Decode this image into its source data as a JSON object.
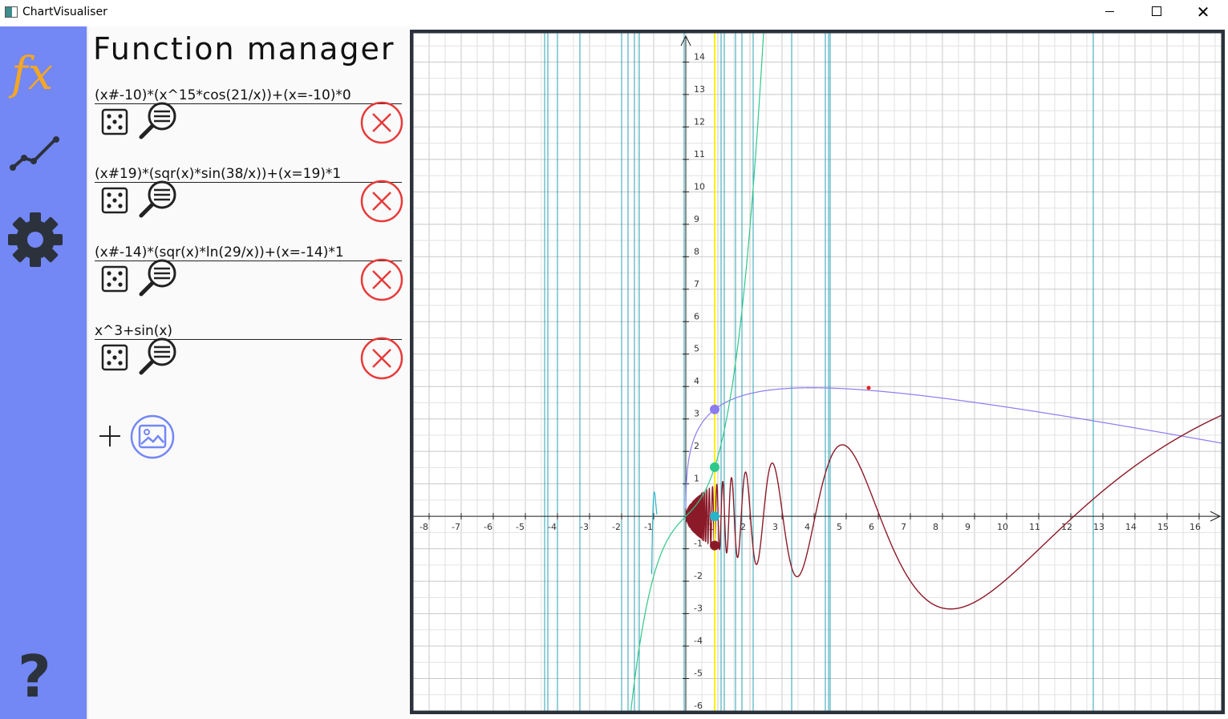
{
  "window": {
    "title": "ChartVisualiser"
  },
  "sidebar": {
    "items": [
      {
        "icon": "fx-icon",
        "label": "fx"
      },
      {
        "icon": "line-chart-icon"
      },
      {
        "icon": "gear-icon"
      },
      {
        "icon": "help-icon",
        "label": "?"
      }
    ],
    "active_color": "#f5a623"
  },
  "panel": {
    "title": "Function manager",
    "functions": [
      {
        "expr": "(x#-10)*(x^15*cos(21/x))+(x=-10)*0",
        "color": "#28b4c8"
      },
      {
        "expr": "(x#19)*(sqr(x)*sin(38/x))+(x=19)*1",
        "color": "#8b1a28"
      },
      {
        "expr": "(x#-14)*(sqr(x)*ln(29/x))+(x=-14)*1",
        "color": "#8a7cf0"
      },
      {
        "expr": "x^3+sin(x)",
        "color": "#2ec98a"
      }
    ],
    "delete_color": "#e83a3a",
    "image_button_color": "#7387f5"
  },
  "chart_data": {
    "type": "line",
    "xlim": [
      -8.5,
      16.7
    ],
    "ylim": [
      -6,
      14.9
    ],
    "grid": true,
    "x_ticks": [
      -8,
      -7,
      -6,
      -5,
      -4,
      -3,
      -2,
      -1,
      1,
      2,
      3,
      4,
      5,
      6,
      7,
      8,
      9,
      10,
      11,
      12,
      13,
      14,
      15,
      16
    ],
    "y_ticks": [
      -6,
      -5,
      -4,
      -3,
      -2,
      -1,
      1,
      2,
      3,
      4,
      5,
      6,
      7,
      8,
      9,
      10,
      11,
      12,
      13,
      14
    ],
    "cursor_x": 0.9,
    "cursor_color": "#ffee00",
    "asymptote_color": "#28a0b4",
    "series": [
      {
        "expr": "sqr(x)*ln(29/x)",
        "color": "#8a7cf0"
      },
      {
        "expr": "sqr(x)*sin(38/x)",
        "color": "#8b1a28"
      },
      {
        "expr": "x^3+sin(x)",
        "color": "#2ec98a"
      }
    ]
  }
}
